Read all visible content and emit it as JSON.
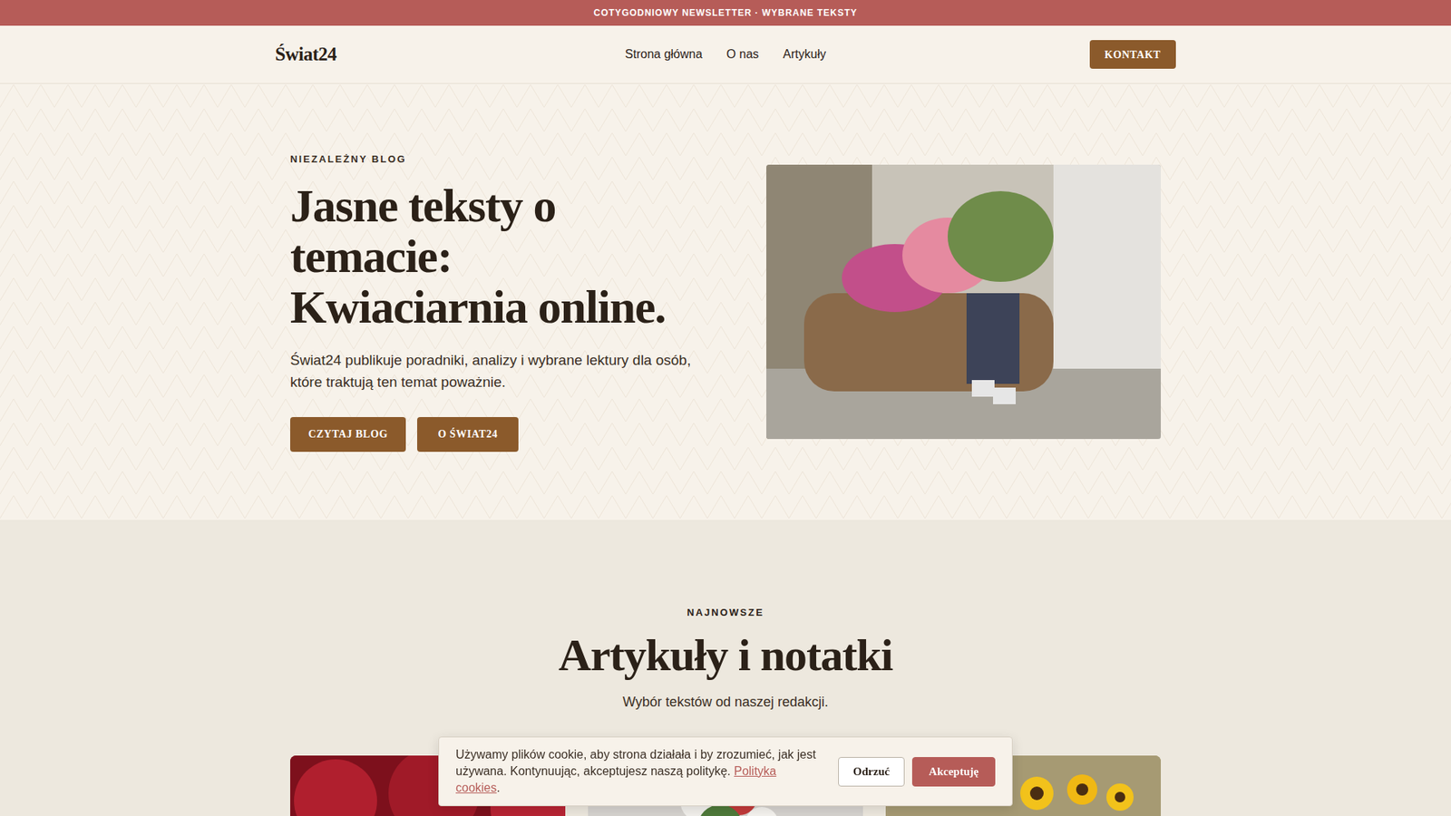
{
  "announcement": {
    "text": "COTYGODNIOWY NEWSLETTER · WYBRANE TEKSTY"
  },
  "nav": {
    "logo": "Świat24",
    "links": [
      {
        "label": "Strona główna"
      },
      {
        "label": "O nas"
      },
      {
        "label": "Artykuły"
      }
    ],
    "cta": "KONTAKT"
  },
  "hero": {
    "eyebrow": "NIEZALEŻNY BLOG",
    "title_lines": [
      "Jasne teksty o",
      "temacie:",
      "Kwiaciarnia online."
    ],
    "lead": "Świat24 publikuje poradniki, analizy i wybrane lektury dla osób, które traktują ten temat poważnie.",
    "buttons": [
      "CZYTAJ BLOG",
      "O ŚWIAT24"
    ]
  },
  "latest": {
    "eyebrow": "NAJNOWSZE",
    "title": "Artykuły i notatki",
    "subtitle": "Wybór tekstów od naszej redakcji."
  },
  "cookie_banner": {
    "text": "Używamy plików cookie, aby strona działała i by zrozumieć, jak jest używana. Kontynuując, akceptujesz naszą politykę. ",
    "link": "Polityka cookies",
    "after_link": ".",
    "buttons": [
      "Odrzuć",
      "Akceptuję"
    ]
  }
}
